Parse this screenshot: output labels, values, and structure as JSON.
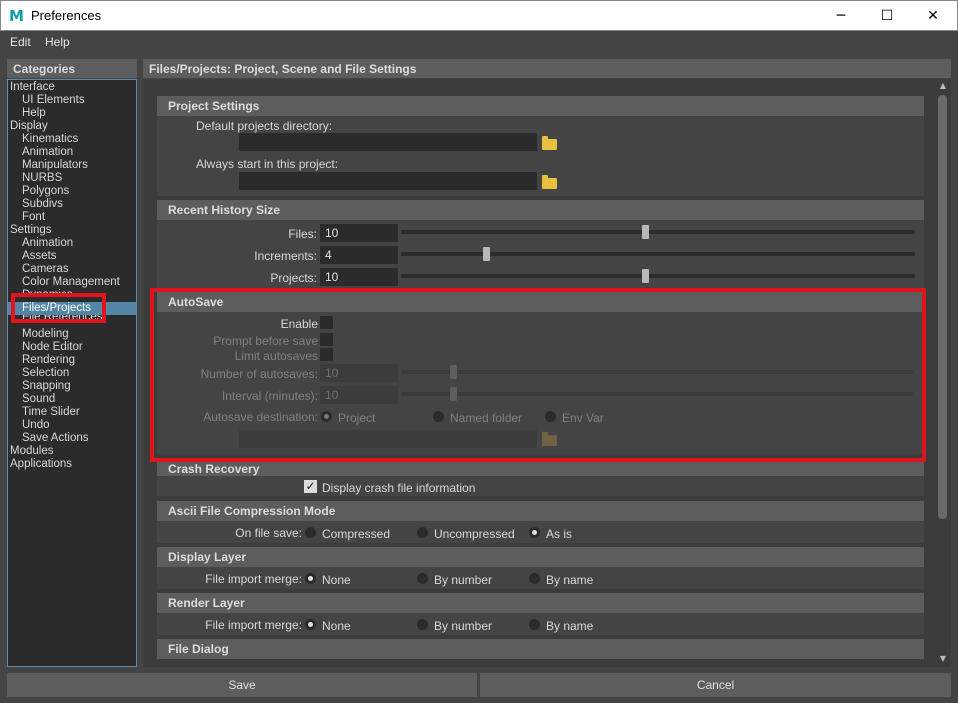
{
  "window": {
    "title": "Preferences",
    "app_icon": "M"
  },
  "window_controls": {
    "minimize": "─",
    "maximize": "☐",
    "close": "✕"
  },
  "menu": {
    "edit": "Edit",
    "help": "Help"
  },
  "categories": {
    "header": "Categories",
    "items": [
      "Interface",
      "UI Elements",
      "Help",
      "Display",
      "Kinematics",
      "Animation",
      "Manipulators",
      "NURBS",
      "Polygons",
      "Subdivs",
      "Font",
      "Settings",
      "Animation",
      "Assets",
      "Cameras",
      "Color Management",
      "Dynamics",
      "Files/Projects",
      "File References",
      "Modeling",
      "Node Editor",
      "Rendering",
      "Selection",
      "Snapping",
      "Sound",
      "Time Slider",
      "Undo",
      "Save Actions",
      "Modules",
      "Applications"
    ],
    "selected": "Files/Projects"
  },
  "main": {
    "header": "Files/Projects: Project, Scene and File Settings"
  },
  "project_settings": {
    "title": "Project Settings",
    "default_dir_label": "Default projects directory:",
    "default_dir_value": "",
    "always_start_label": "Always start in this project:",
    "always_start_value": ""
  },
  "recent_history": {
    "title": "Recent History Size",
    "files_label": "Files:",
    "files_value": "10",
    "increments_label": "Increments:",
    "increments_value": "4",
    "projects_label": "Projects:",
    "projects_value": "10"
  },
  "autosave": {
    "title": "AutoSave",
    "enable_label": "Enable",
    "enable_checked": false,
    "prompt_label": "Prompt before save",
    "prompt_checked": false,
    "limit_label": "Limit autosaves",
    "limit_checked": false,
    "num_label": "Number of autosaves:",
    "num_value": "10",
    "interval_label": "Interval (minutes):",
    "interval_value": "10",
    "dest_label": "Autosave destination:",
    "dest_project": "Project",
    "dest_named": "Named folder",
    "dest_env": "Env Var",
    "dest_selected": "Project",
    "folder_value": ""
  },
  "crash_recovery": {
    "title": "Crash Recovery",
    "display_label": "Display crash file information",
    "display_checked": true
  },
  "ascii": {
    "title": "Ascii File Compression Mode",
    "on_save_label": "On file save:",
    "compressed": "Compressed",
    "uncompressed": "Uncompressed",
    "as_is": "As is",
    "selected": "As is"
  },
  "display_layer": {
    "title": "Display Layer",
    "merge_label": "File import merge:",
    "none": "None",
    "by_number": "By number",
    "by_name": "By name",
    "selected": "None"
  },
  "render_layer": {
    "title": "Render Layer",
    "merge_label": "File import merge:",
    "none": "None",
    "by_number": "By number",
    "by_name": "By name",
    "selected": "None"
  },
  "file_dialog": {
    "title": "File Dialog"
  },
  "buttons": {
    "save": "Save",
    "cancel": "Cancel"
  },
  "colors": {
    "highlight": "#e0141c",
    "selection": "#5285a6",
    "panel": "#444444"
  }
}
